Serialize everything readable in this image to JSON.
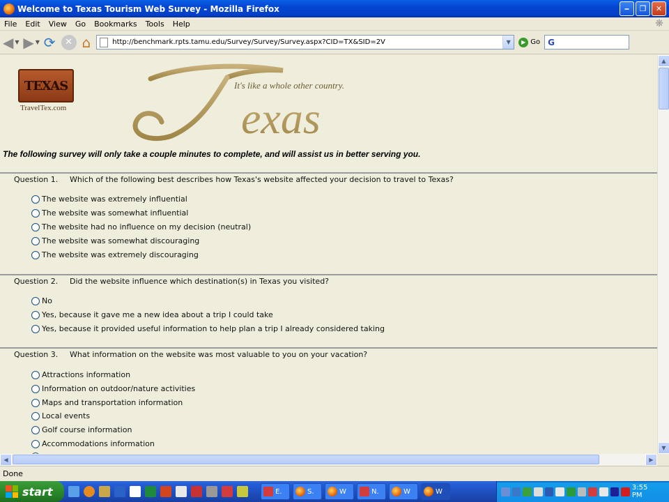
{
  "window": {
    "title": "Welcome to Texas Tourism Web Survey - Mozilla Firefox"
  },
  "menu": [
    "File",
    "Edit",
    "View",
    "Go",
    "Bookmarks",
    "Tools",
    "Help"
  ],
  "nav": {
    "url": "http://benchmark.rpts.tamu.edu/Survey/Survey/Survey.aspx?CID=TX&SID=2V",
    "go_label": "Go"
  },
  "page": {
    "logo_patch": "TEXAS",
    "logo_site": "TravelTex.com",
    "logo_script": "exas",
    "tagline": "It's like a whole other country.",
    "intro": "The following survey will only take a couple minutes to complete, and will assist us in better serving you."
  },
  "questions": [
    {
      "number": "Question 1.",
      "text": "Which of the following best describes how Texas's website affected your decision to travel to Texas?",
      "options": [
        "The website was extremely influential",
        "The website was somewhat influential",
        "The website had no influence on my decision (neutral)",
        "The website was somewhat discouraging",
        "The website was extremely discouraging"
      ]
    },
    {
      "number": "Question 2.",
      "text": "Did the website influence which destination(s) in Texas you visited?",
      "options": [
        "No",
        "Yes, because it gave me a new idea about a trip I could take",
        "Yes, because it provided useful information to help plan a trip I already considered taking"
      ]
    },
    {
      "number": "Question 3.",
      "text": "What information on the website was most valuable to you on your vacation?",
      "options": [
        "Attractions information",
        "Information on outdoor/nature activities",
        "Maps and transportation information",
        "Local events",
        "Golf course information",
        "Accommodations information"
      ]
    }
  ],
  "status": {
    "text": "Done"
  },
  "taskbar": {
    "start_label": "start",
    "items": [
      "E.",
      "S.",
      "W",
      "N.",
      "W",
      "W"
    ],
    "clock": "3:55 PM"
  }
}
